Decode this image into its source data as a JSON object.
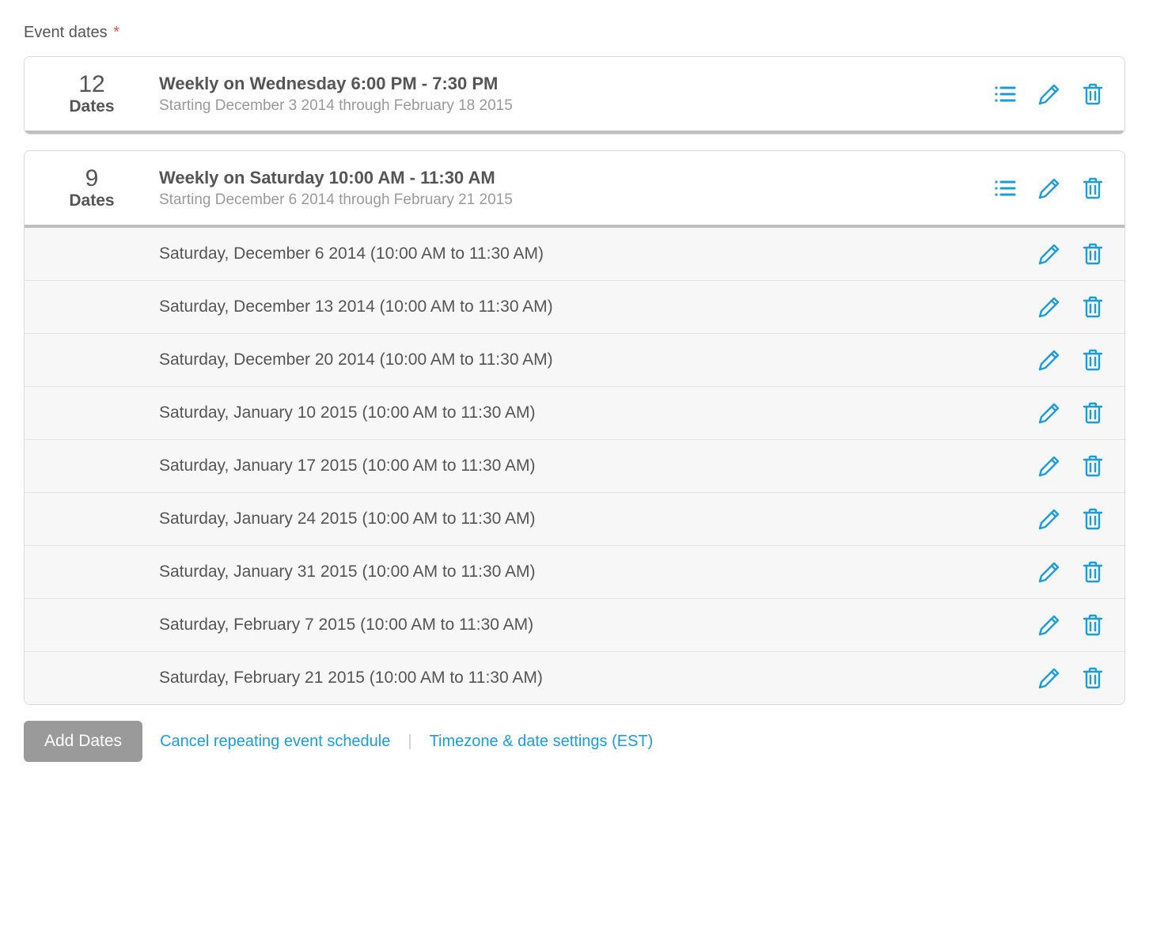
{
  "section_label": "Event dates",
  "required_mark": "*",
  "schedules": [
    {
      "count_number": "12",
      "count_label": "Dates",
      "title": "Weekly on Wednesday 6:00 PM - 7:30 PM",
      "subtitle": "Starting December 3 2014 through February 18 2015",
      "expanded_dates": []
    },
    {
      "count_number": "9",
      "count_label": "Dates",
      "title": "Weekly on Saturday 10:00 AM - 11:30 AM",
      "subtitle": "Starting December 6 2014 through February 21 2015",
      "expanded_dates": [
        "Saturday, December 6 2014 (10:00 AM to 11:30 AM)",
        "Saturday, December 13 2014 (10:00 AM to 11:30 AM)",
        "Saturday, December 20 2014 (10:00 AM to 11:30 AM)",
        "Saturday, January 10 2015 (10:00 AM to 11:30 AM)",
        "Saturday, January 17 2015 (10:00 AM to 11:30 AM)",
        "Saturday, January 24 2015 (10:00 AM to 11:30 AM)",
        "Saturday, January 31 2015 (10:00 AM to 11:30 AM)",
        "Saturday, February 7 2015 (10:00 AM to 11:30 AM)",
        "Saturday, February 21 2015 (10:00 AM to 11:30 AM)"
      ]
    }
  ],
  "footer": {
    "add_dates": "Add Dates",
    "cancel_link": "Cancel repeating event schedule",
    "timezone_link": "Timezone & date settings (EST)"
  },
  "colors": {
    "accent": "#1b9dd9",
    "text": "#555555",
    "muted": "#9a9a9a",
    "required": "#d9534f"
  }
}
